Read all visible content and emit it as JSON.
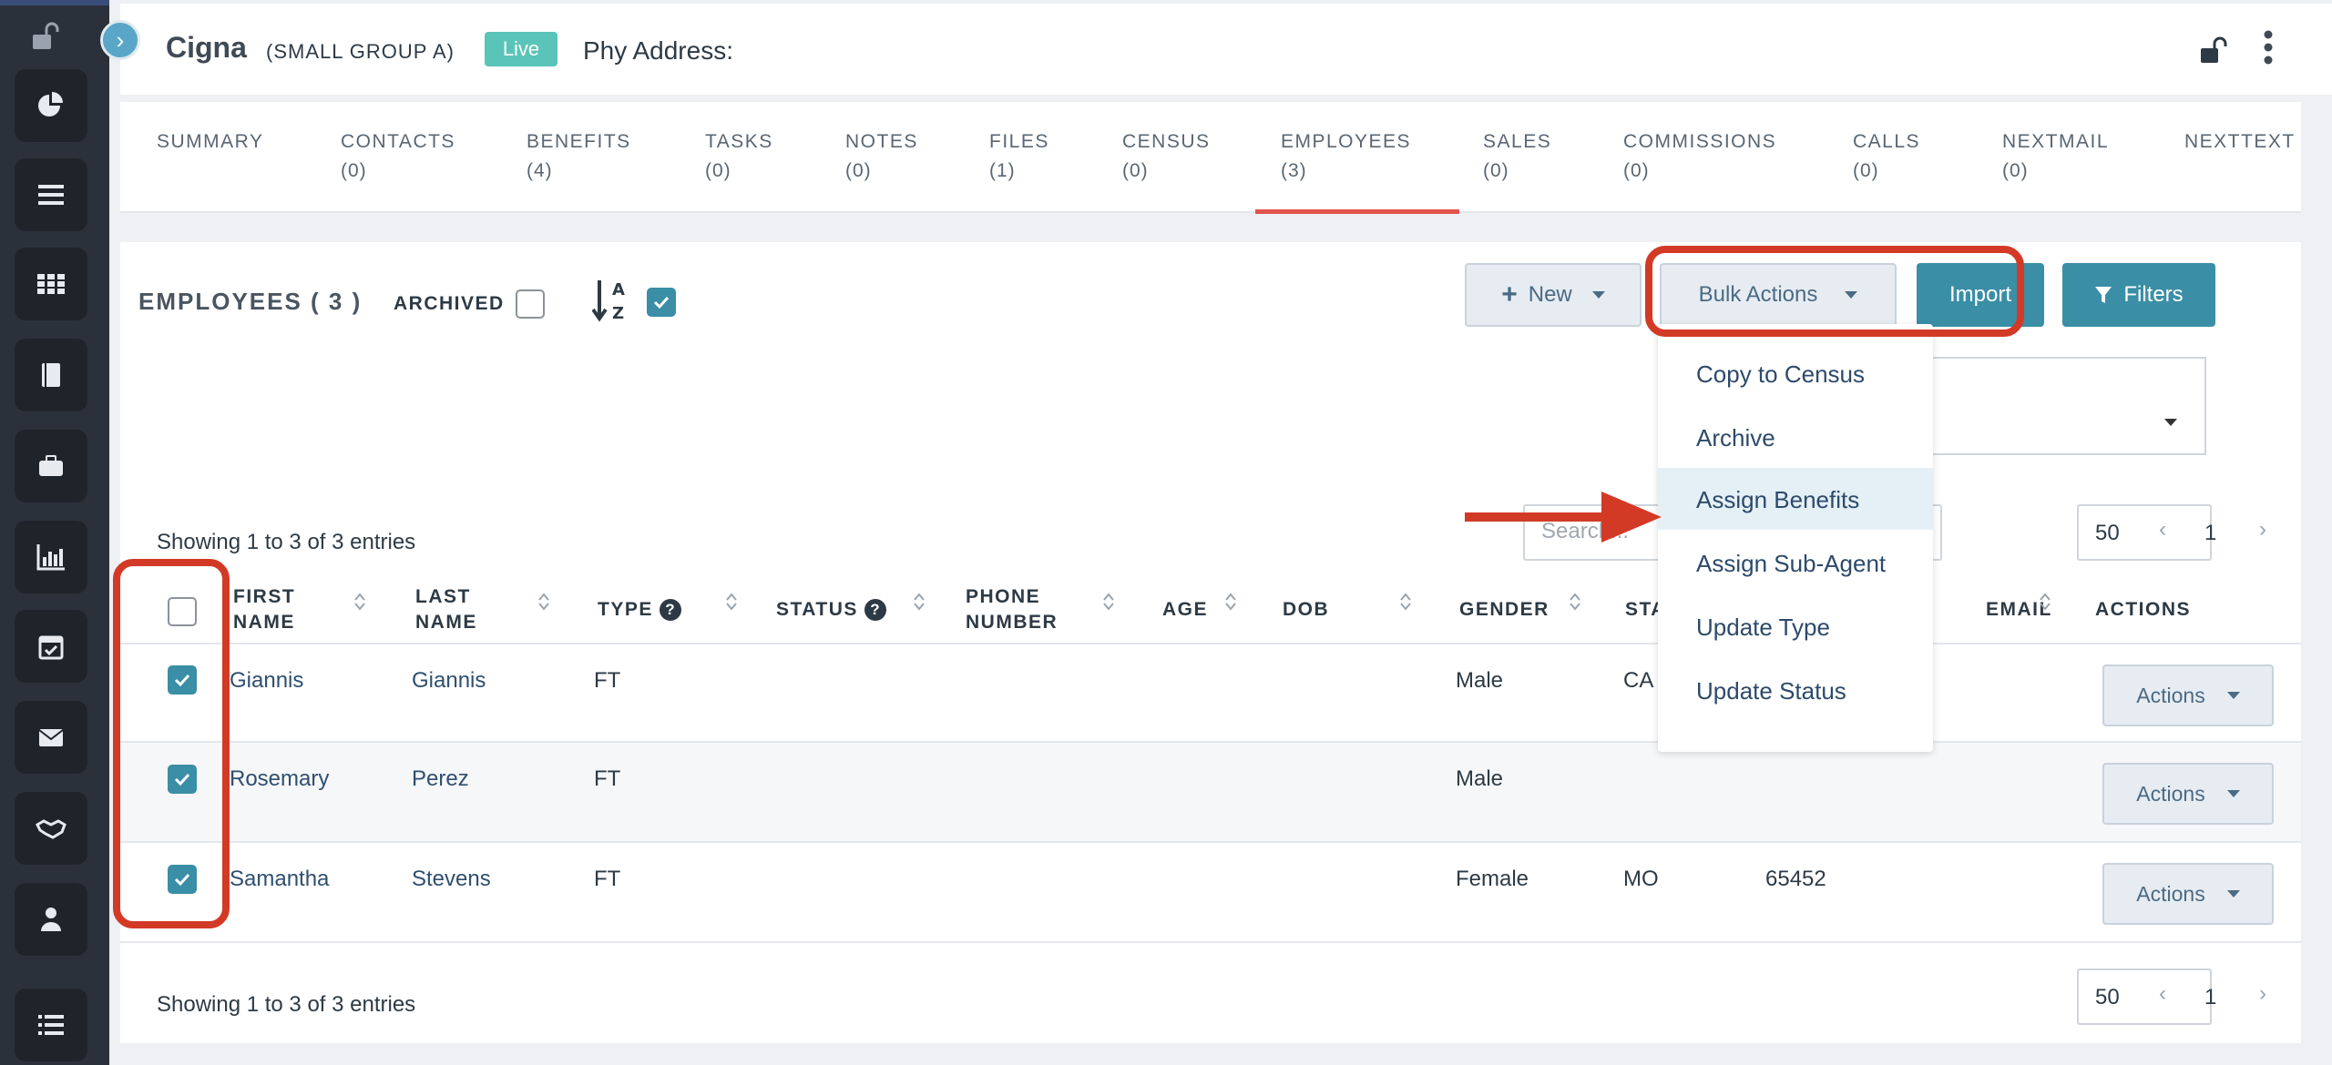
{
  "header": {
    "company": "Cigna",
    "group": "(SMALL GROUP A)",
    "status_badge": "Live",
    "phy_address_label": "Phy Address:"
  },
  "tabs": [
    {
      "label": "SUMMARY",
      "count": ""
    },
    {
      "label": "CONTACTS",
      "count": "(0)"
    },
    {
      "label": "BENEFITS",
      "count": "(4)"
    },
    {
      "label": "TASKS",
      "count": "(0)"
    },
    {
      "label": "NOTES",
      "count": "(0)"
    },
    {
      "label": "FILES",
      "count": "(1)"
    },
    {
      "label": "CENSUS",
      "count": "(0)"
    },
    {
      "label": "EMPLOYEES",
      "count": "(3)"
    },
    {
      "label": "SALES",
      "count": "(0)"
    },
    {
      "label": "COMMISSIONS",
      "count": "(0)"
    },
    {
      "label": "CALLS",
      "count": "(0)"
    },
    {
      "label": "NEXTMAIL",
      "count": "(0)"
    },
    {
      "label": "NEXTTEXT",
      "count": ""
    }
  ],
  "active_tab": "EMPLOYEES",
  "employees": {
    "title": "EMPLOYEES ( 3 )",
    "archived_label": "ARCHIVED",
    "new_label": "New",
    "bulk_label": "Bulk Actions",
    "import_label": "Import",
    "filters_label": "Filters",
    "search_placeholder": "Search...",
    "per_page": "50",
    "showing_top": "Showing 1 to 3 of 3 entries",
    "showing_bottom": "Showing 1 to 3 of 3 entries",
    "page_prev": "‹",
    "page_current": "1",
    "page_next": "›"
  },
  "bulk_menu": [
    "Copy to Census",
    "Archive",
    "Assign Benefits",
    "Assign Sub-Agent",
    "Update Type",
    "Update Status"
  ],
  "bulk_menu_highlighted": "Assign Benefits",
  "table": {
    "headers": {
      "first_name": [
        "FIRST",
        "NAME"
      ],
      "last_name": [
        "LAST",
        "NAME"
      ],
      "type": "TYPE",
      "status": "STATUS",
      "phone": [
        "PHONE",
        "NUMBER"
      ],
      "age": "AGE",
      "dob": "DOB",
      "gender": "GENDER",
      "state": "STA",
      "email": "EMAIL",
      "actions": "ACTIONS"
    },
    "rows": [
      {
        "first": "Giannis",
        "last": "Giannis",
        "type": "FT",
        "gender": "Male",
        "state": "CA",
        "zip": "",
        "checked": true
      },
      {
        "first": "Rosemary",
        "last": "Perez",
        "type": "FT",
        "gender": "Male",
        "state": "",
        "zip": "",
        "checked": true
      },
      {
        "first": "Samantha",
        "last": "Stevens",
        "type": "FT",
        "gender": "Female",
        "state": "MO",
        "zip": "65452",
        "checked": true
      }
    ],
    "row_action_label": "Actions"
  },
  "colors": {
    "sidebar": "#2b313b",
    "accent": "#3a8ea6",
    "live": "#5bc4b8",
    "active_tab": "#e2554c",
    "annotation": "#d33a26"
  },
  "icons": {
    "sidebar": [
      "lock-icon",
      "pie-chart-icon",
      "list-icon",
      "grid-icon",
      "book-icon",
      "briefcase-icon",
      "bar-chart-icon",
      "calendar-check-icon",
      "envelope-icon",
      "handshake-icon",
      "user-icon",
      "list-ul-icon"
    ]
  }
}
